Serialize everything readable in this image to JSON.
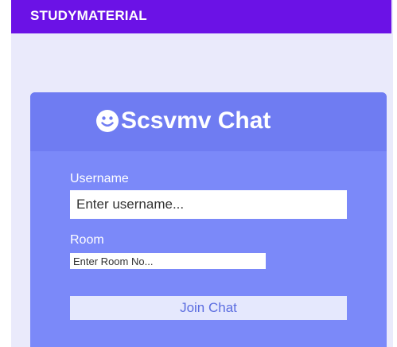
{
  "appbar": {
    "title": "STUDYMATERIAL"
  },
  "colors": {
    "appbar": "#6b12e6",
    "background": "#eaeafb",
    "card": "#7b89f9",
    "card_header": "#6f7cf2",
    "button_bg": "#e5e8fd",
    "button_text": "#5b6de0"
  },
  "header": {
    "icon": "smiley-face-icon",
    "title": "Scsvmv Chat"
  },
  "form": {
    "username": {
      "label": "Username",
      "placeholder": "Enter username...",
      "value": ""
    },
    "room": {
      "label": "Room",
      "placeholder": "Enter Room No...",
      "value": ""
    },
    "submit_label": "Join Chat"
  }
}
